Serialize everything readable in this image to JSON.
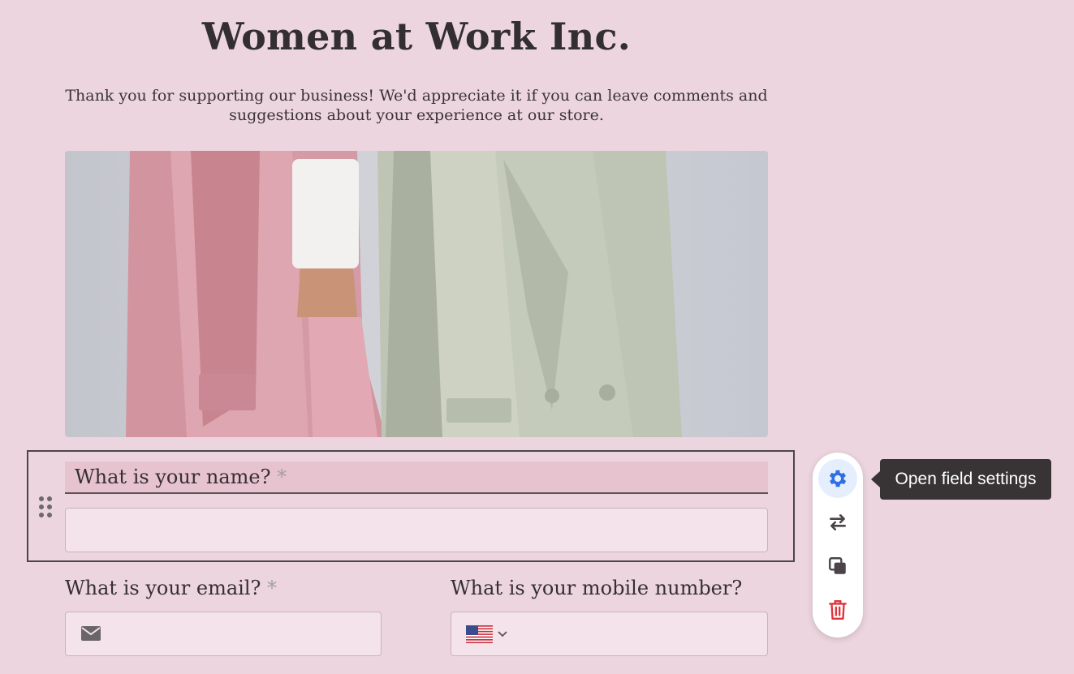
{
  "form": {
    "title": "Women at Work Inc.",
    "description": "Thank you for supporting our business! We'd appreciate it if you can leave comments and suggestions about your experience at our store."
  },
  "fields": {
    "name": {
      "label": "What is your name?",
      "required_mark": "*",
      "value": ""
    },
    "email": {
      "label": "What is your email?",
      "required_mark": "*",
      "value": "",
      "icon": "mail-icon"
    },
    "mobile": {
      "label": "What is your mobile number?",
      "value": "",
      "country_flag": "us-flag-icon"
    }
  },
  "toolbar": {
    "tooltip": "Open field settings",
    "items": [
      "gear-icon",
      "swap-icon",
      "duplicate-icon",
      "trash-icon"
    ]
  },
  "colors": {
    "page_bg": "#ecd5de",
    "accent": "#2f6fe4",
    "delete": "#e0343c",
    "tooltip_bg": "#383436"
  }
}
